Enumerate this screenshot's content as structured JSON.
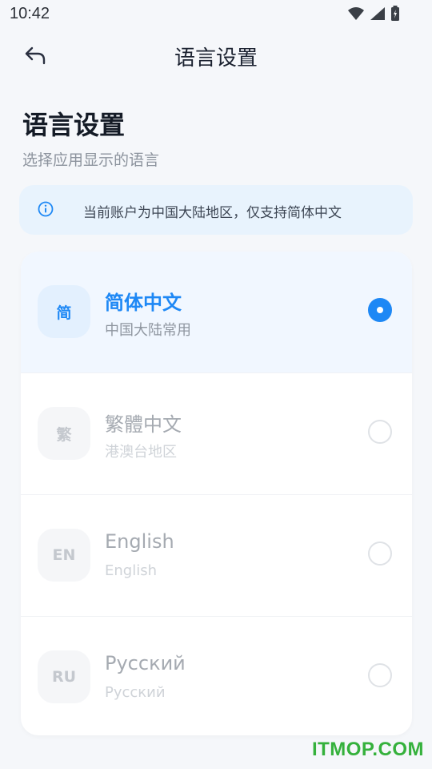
{
  "status_bar": {
    "time": "10:42"
  },
  "appbar": {
    "title": "语言设置"
  },
  "page": {
    "heading": "语言设置",
    "subtitle": "选择应用显示的语言"
  },
  "notice": {
    "text": "当前账户为中国大陆地区，仅支持简体中文"
  },
  "languages": [
    {
      "badge": "简",
      "name": "简体中文",
      "desc": "中国大陆常用",
      "selected": true
    },
    {
      "badge": "繁",
      "name": "繁體中文",
      "desc": "港澳台地区",
      "selected": false
    },
    {
      "badge": "EN",
      "name": "English",
      "desc": "English",
      "selected": false
    },
    {
      "badge": "RU",
      "name": "Русский",
      "desc": "Русский",
      "selected": false
    }
  ],
  "watermark": "ITMOP.COM",
  "colors": {
    "accent": "#1e88f5",
    "notice_bg": "#e8f3fd",
    "watermark": "#35b13c"
  }
}
